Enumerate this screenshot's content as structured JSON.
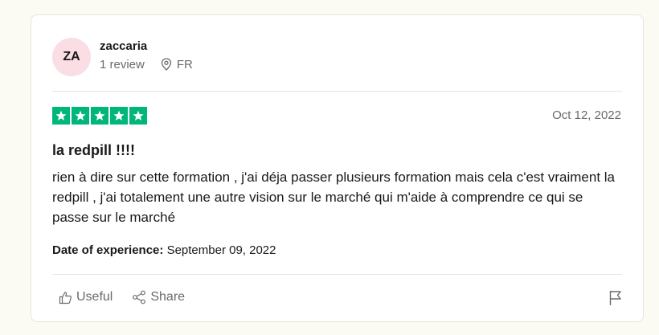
{
  "review": {
    "avatar_initials": "ZA",
    "avatar_color": "#fbdde4",
    "username": "zaccaria",
    "review_count": "1 review",
    "location": "FR",
    "rating": 5,
    "star_color": "#00b67a",
    "date": "Oct 12, 2022",
    "title": "la redpill !!!!",
    "body": "rien à dire sur cette formation , j'ai déja passer plusieurs formation mais cela c'est vraiment la redpill , j'ai totalement une autre vision sur le marché qui m'aide à comprendre ce qui se passe sur le marché",
    "experience_label": "Date of experience:",
    "experience_date": "September 09, 2022"
  },
  "actions": {
    "useful_label": "Useful",
    "share_label": "Share"
  },
  "icons": [
    "location-pin-icon",
    "star-icon",
    "thumbs-up-icon",
    "share-icon",
    "flag-icon"
  ]
}
